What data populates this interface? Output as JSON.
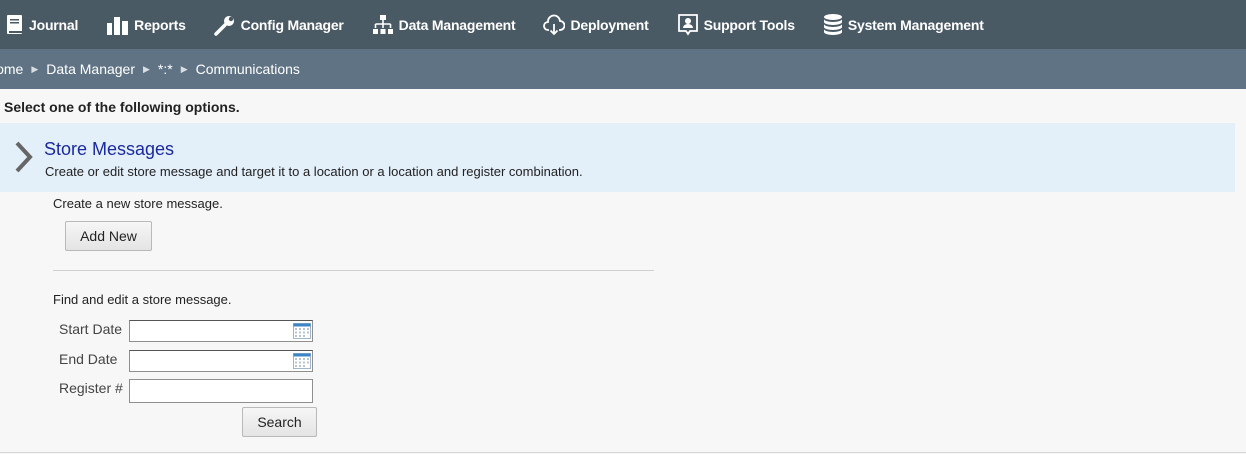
{
  "nav": {
    "items": [
      {
        "label": "Journal",
        "icon": "book-icon"
      },
      {
        "label": "Reports",
        "icon": "bar-chart-icon"
      },
      {
        "label": "Config Manager",
        "icon": "wrench-icon"
      },
      {
        "label": "Data Management",
        "icon": "hierarchy-icon"
      },
      {
        "label": "Deployment",
        "icon": "cloud-download-icon"
      },
      {
        "label": "Support Tools",
        "icon": "support-person-icon"
      },
      {
        "label": "System Management",
        "icon": "database-icon"
      }
    ]
  },
  "breadcrumb": {
    "items": [
      "Home",
      "Data Manager",
      "*:*",
      "Communications"
    ],
    "first_visible": "lome"
  },
  "instruction": "Select one of the following options.",
  "section": {
    "title": "Store Messages",
    "description": "Create or edit store message and target it to a location or a location and register combination."
  },
  "create": {
    "text": "Create a new store message.",
    "button_label": "Add New"
  },
  "find": {
    "text": "Find and edit a store message.",
    "start_date_label": "Start Date",
    "start_date_value": "",
    "end_date_label": "End Date",
    "end_date_value": "",
    "register_label": "Register #",
    "register_value": "",
    "search_label": "Search"
  },
  "colors": {
    "topnav_bg": "#4a5a65",
    "breadcrumb_bg": "#5f7385",
    "section_bg": "#e3eff9",
    "section_title": "#1a2a9e"
  }
}
